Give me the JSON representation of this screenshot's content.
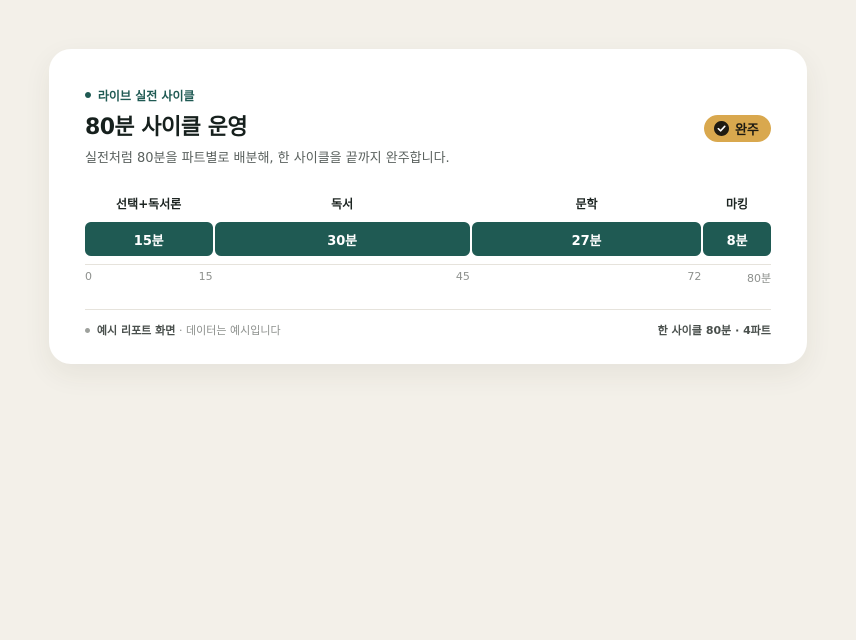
{
  "card": {
    "eyebrow": "라이브 실전 사이클",
    "title": "80분 사이클 운영",
    "badge": "완주",
    "description": "실전처럼 80분을 파트별로 배분해, 한 사이클을 끝까지 완주합니다."
  },
  "timeline": {
    "total_minutes": 80,
    "segments": [
      {
        "name": "선택+독서론",
        "duration_label": "15분",
        "start": 0,
        "end": 15
      },
      {
        "name": "독서",
        "duration_label": "30분",
        "start": 15,
        "end": 45
      },
      {
        "name": "문학",
        "duration_label": "27분",
        "start": 45,
        "end": 72
      },
      {
        "name": "마킹",
        "duration_label": "8분",
        "start": 72,
        "end": 80
      }
    ],
    "ticks": [
      "0",
      "15",
      "45",
      "72",
      "80분"
    ]
  },
  "footer": {
    "label_strong": "예시 리포트 화면",
    "label_note": " · 데이터는 예시입니다",
    "summary": "한 사이클 80분 · 4파트"
  },
  "colors": {
    "accent": "#1f5a53",
    "badge": "#d9a84e",
    "background": "#f3f0e9"
  },
  "icons": {
    "badge_icon": "check-circle-icon"
  }
}
